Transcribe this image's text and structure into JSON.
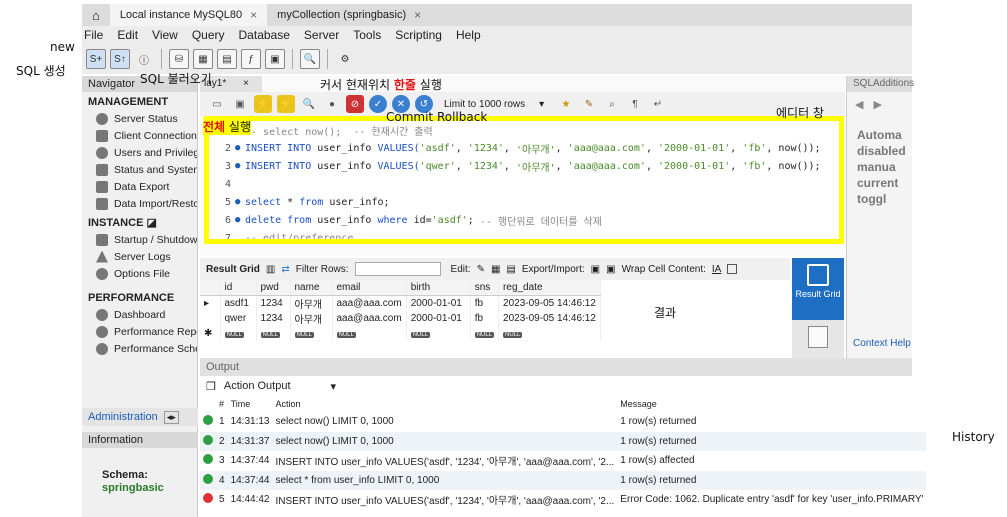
{
  "tabs": [
    "Local instance MySQL80",
    "myCollection (springbasic)"
  ],
  "menu": [
    "File",
    "Edit",
    "View",
    "Query",
    "Database",
    "Server",
    "Tools",
    "Scripting",
    "Help"
  ],
  "toolbar_icons": [
    "new-sql-icon",
    "open-sql-icon",
    "info-icon",
    "db-icon",
    "table-icon",
    "view-icon",
    "proc-icon",
    "func-icon",
    "search-icon",
    "reconnect-icon"
  ],
  "navigator": {
    "title": "Navigator",
    "management": {
      "title": "MANAGEMENT",
      "items": [
        "Server Status",
        "Client Connection",
        "Users and Privileg",
        "Status and System",
        "Data Export",
        "Data Import/Resto"
      ]
    },
    "instance": {
      "title": "INSTANCE",
      "items": [
        "Startup / Shutdow",
        "Server Logs",
        "Options File"
      ]
    },
    "performance": {
      "title": "PERFORMANCE",
      "items": [
        "Dashboard",
        "Performance Repo",
        "Performance Sche"
      ]
    },
    "admin_tab": "Administration",
    "info_title": "Information",
    "schema_label": "Schema:",
    "schema_value": "springbasic"
  },
  "query_tab": "lay1*",
  "limit_select": "Limit to 1000 rows",
  "editor": {
    "lines": [
      {
        "n": "1",
        "parts": [
          [
            "cmt",
            "-- select now();  -- 현재시간 출력"
          ]
        ]
      },
      {
        "n": "2",
        "parts": [
          [
            "kw",
            "INSERT INTO "
          ],
          [
            "plain",
            "user_info "
          ],
          [
            "kw",
            "VALUES("
          ],
          [
            "str",
            "'asdf'"
          ],
          [
            "plain",
            ", "
          ],
          [
            "str",
            "'1234'"
          ],
          [
            "plain",
            ", "
          ],
          [
            "str",
            "'아무개'"
          ],
          [
            "plain",
            ", "
          ],
          [
            "str",
            "'aaa@aaa.com'"
          ],
          [
            "plain",
            ", "
          ],
          [
            "str",
            "'2000-01-01'"
          ],
          [
            "plain",
            ", "
          ],
          [
            "str",
            "'fb'"
          ],
          [
            "plain",
            ", now());"
          ]
        ]
      },
      {
        "n": "3",
        "parts": [
          [
            "kw",
            "INSERT INTO "
          ],
          [
            "plain",
            "user_info "
          ],
          [
            "kw",
            "VALUES("
          ],
          [
            "str",
            "'qwer'"
          ],
          [
            "plain",
            ", "
          ],
          [
            "str",
            "'1234'"
          ],
          [
            "plain",
            ", "
          ],
          [
            "str",
            "'아무개'"
          ],
          [
            "plain",
            ", "
          ],
          [
            "str",
            "'aaa@aaa.com'"
          ],
          [
            "plain",
            ", "
          ],
          [
            "str",
            "'2000-01-01'"
          ],
          [
            "plain",
            ", "
          ],
          [
            "str",
            "'fb'"
          ],
          [
            "plain",
            ", now());"
          ]
        ]
      },
      {
        "n": "4",
        "parts": []
      },
      {
        "n": "5",
        "parts": [
          [
            "kw",
            "select "
          ],
          [
            "plain",
            "* "
          ],
          [
            "kw",
            "from "
          ],
          [
            "plain",
            "user_info;"
          ]
        ]
      },
      {
        "n": "6",
        "parts": [
          [
            "kw",
            "delete from "
          ],
          [
            "plain",
            "user_info "
          ],
          [
            "kw",
            "where "
          ],
          [
            "plain",
            "id="
          ],
          [
            "str",
            "'asdf'"
          ],
          [
            "plain",
            "; "
          ],
          [
            "cmt",
            "-- 행단위로 데이터를 삭제"
          ]
        ]
      },
      {
        "n": "7",
        "parts": [
          [
            "cmt",
            "-- edit/preference"
          ]
        ]
      }
    ]
  },
  "result": {
    "grid_label": "Result Grid",
    "filter_label": "Filter Rows:",
    "edit_label": "Edit:",
    "export_label": "Export/Import:",
    "wrap_label": "Wrap Cell Content:",
    "columns": [
      "id",
      "pwd",
      "name",
      "email",
      "birth",
      "sns",
      "reg_date"
    ],
    "rows": [
      [
        "asdf1",
        "1234",
        "아무개",
        "aaa@aaa.com",
        "2000-01-01",
        "fb",
        "2023-09-05 14:46:12"
      ],
      [
        "qwer",
        "1234",
        "아무개",
        "aaa@aaa.com",
        "2000-01-01",
        "fb",
        "2023-09-05 14:46:12"
      ]
    ],
    "null_text": "NULL",
    "side_button": "Result Grid"
  },
  "sqladditions": {
    "title": "SQLAdditions",
    "text": [
      "Automa",
      "disabled",
      "manua",
      "current",
      "toggl"
    ],
    "context_help": "Context Help"
  },
  "output": {
    "title": "Output",
    "selector": "Action Output",
    "headers": [
      "#",
      "Time",
      "Action",
      "Message"
    ],
    "rows": [
      {
        "status": "ok",
        "n": "1",
        "time": "14:31:13",
        "action": "select now() LIMIT 0, 1000",
        "msg": "1 row(s) returned"
      },
      {
        "status": "ok",
        "n": "2",
        "time": "14:31:37",
        "action": "select now() LIMIT 0, 1000",
        "msg": "1 row(s) returned"
      },
      {
        "status": "ok",
        "n": "3",
        "time": "14:37:44",
        "action": "INSERT INTO user_info VALUES('asdf', '1234', '아무개', 'aaa@aaa.com', '2...",
        "msg": "1 row(s) affected"
      },
      {
        "status": "ok",
        "n": "4",
        "time": "14:37:44",
        "action": "select * from user_info LIMIT 0, 1000",
        "msg": "1 row(s) returned"
      },
      {
        "status": "err",
        "n": "5",
        "time": "14:44:42",
        "action": "INSERT INTO user_info VALUES('asdf', '1234', '아무개', 'aaa@aaa.com', '2...",
        "msg": "Error Code: 1062. Duplicate entry 'asdf' for key 'user_info.PRIMARY'"
      }
    ]
  },
  "annotations": {
    "new": "new",
    "sql_create": "SQL 생성",
    "sql_load": "SQL 불러오기",
    "cursor_pre": "커서 현재위치 ",
    "cursor_red": "한줄",
    "cursor_post": " 실행",
    "run_all_red": "전체",
    "run_all_post": " 실행",
    "commit": "Commit Rollback",
    "editor_win": "에디터 창",
    "result": "결과",
    "history": "History"
  }
}
